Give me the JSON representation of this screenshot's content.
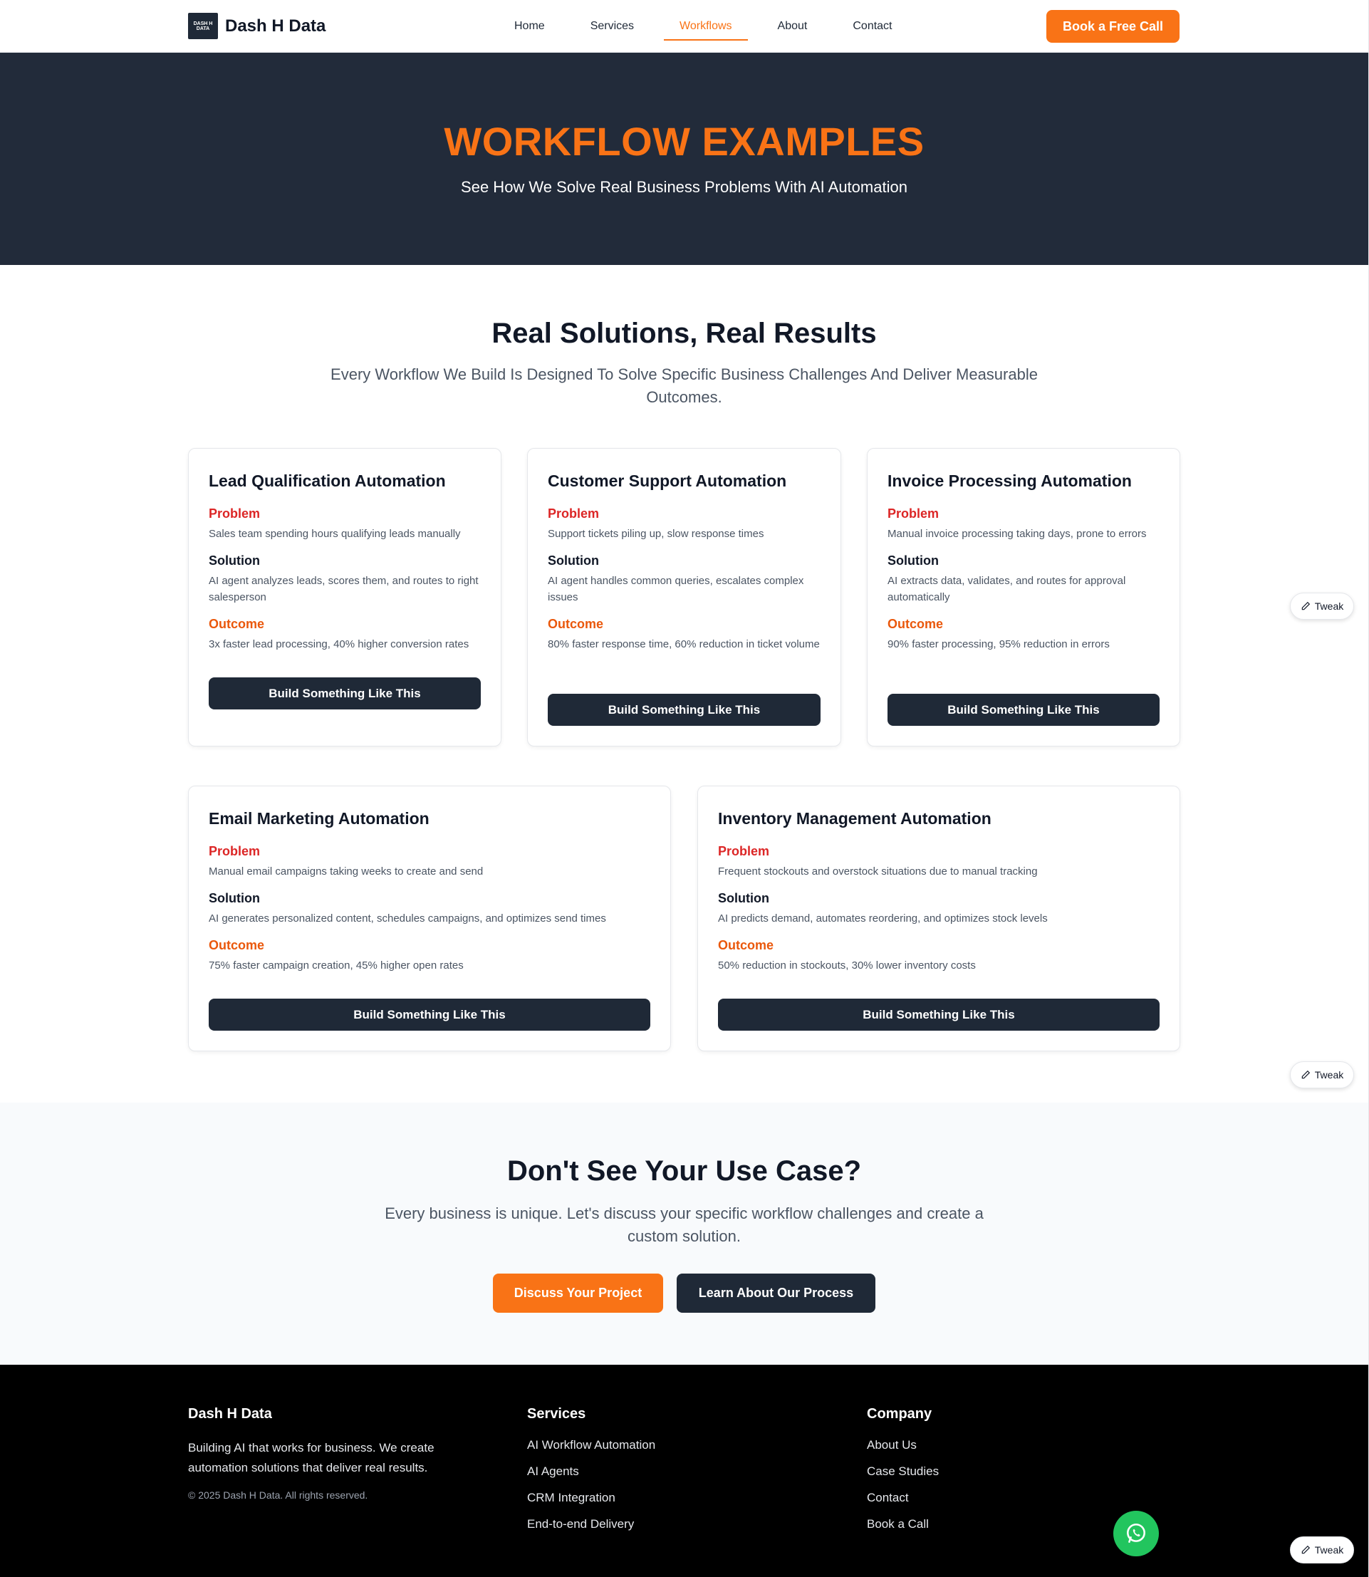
{
  "nav": {
    "logo_text": "DASH H DATA",
    "brand": "Dash H Data",
    "links": [
      "Home",
      "Services",
      "Workflows",
      "About",
      "Contact"
    ],
    "active": "Workflows",
    "cta": "Book a Free Call"
  },
  "hero": {
    "title": "WORKFLOW EXAMPLES",
    "subtitle": "See How We Solve Real Business Problems With AI Automation"
  },
  "solutions": {
    "title": "Real Solutions, Real Results",
    "subtitle": "Every Workflow We Build Is Designed To Solve Specific Business Challenges And Deliver Measurable Outcomes."
  },
  "labels": {
    "problem": "Problem",
    "solution": "Solution",
    "outcome": "Outcome",
    "button": "Build Something Like This"
  },
  "cards": [
    {
      "title": "Lead Qualification Automation",
      "problem": "Sales team spending hours qualifying leads manually",
      "solution": "AI agent analyzes leads, scores them, and routes to right salesperson",
      "outcome": "3x faster lead processing, 40% higher conversion rates"
    },
    {
      "title": "Customer Support Automation",
      "problem": "Support tickets piling up, slow response times",
      "solution": "AI agent handles common queries, escalates complex issues",
      "outcome": "80% faster response time, 60% reduction in ticket volume"
    },
    {
      "title": "Invoice Processing Automation",
      "problem": "Manual invoice processing taking days, prone to errors",
      "solution": "AI extracts data, validates, and routes for approval automatically",
      "outcome": "90% faster processing, 95% reduction in errors"
    },
    {
      "title": "Email Marketing Automation",
      "problem": "Manual email campaigns taking weeks to create and send",
      "solution": "AI generates personalized content, schedules campaigns, and optimizes send times",
      "outcome": "75% faster campaign creation, 45% higher open rates"
    },
    {
      "title": "Inventory Management Automation",
      "problem": "Frequent stockouts and overstock situations due to manual tracking",
      "solution": "AI predicts demand, automates reordering, and optimizes stock levels",
      "outcome": "50% reduction in stockouts, 30% lower inventory costs"
    }
  ],
  "cta": {
    "title": "Don't See Your Use Case?",
    "subtitle": "Every business is unique. Let's discuss your specific workflow challenges and create a custom solution.",
    "primary": "Discuss Your Project",
    "secondary": "Learn About Our Process"
  },
  "footer": {
    "brand": "Dash H Data",
    "description": "Building AI that works for business. We create automation solutions that deliver real results.",
    "copyright": "© 2025 Dash H Data. All rights reserved.",
    "services_title": "Services",
    "services": [
      "AI Workflow Automation",
      "AI Agents",
      "CRM Integration",
      "End-to-end Delivery"
    ],
    "company_title": "Company",
    "company": [
      "About Us",
      "Case Studies",
      "Contact",
      "Book a Call"
    ]
  },
  "tweak_label": "Tweak",
  "colors": {
    "accent": "#f97316",
    "dark": "#1f2937",
    "hero_bg": "#222b3a",
    "problem": "#dc2626",
    "outcome": "#ea580c",
    "whatsapp": "#22c55e"
  }
}
